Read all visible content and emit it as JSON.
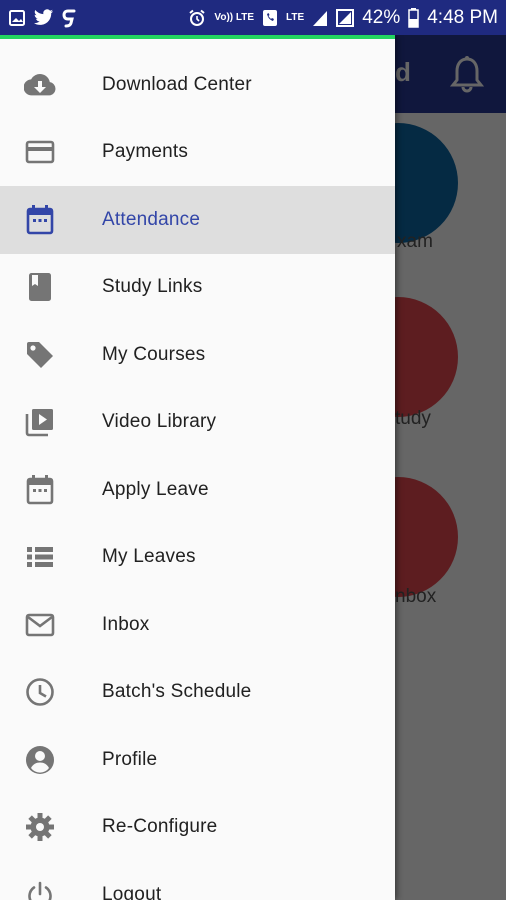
{
  "status_bar": {
    "battery_percent": "42%",
    "time": "4:48 PM",
    "volte_label": "Vo)) LTE",
    "lte_label": "LTE"
  },
  "background_screen": {
    "title_fragment": "d",
    "tiles": [
      {
        "label": "xam",
        "color": "#0d6aa8"
      },
      {
        "label": "tudy",
        "color": "#e84a52"
      },
      {
        "label": "nbox",
        "color": "#e84a52"
      }
    ]
  },
  "drawer": {
    "accent_color": "#23d560",
    "active_color": "#3346a8",
    "items": [
      {
        "label": "Download Center",
        "icon": "cloud-download-icon"
      },
      {
        "label": "Payments",
        "icon": "credit-card-icon"
      },
      {
        "label": "Attendance",
        "icon": "calendar-icon",
        "active": true
      },
      {
        "label": "Study Links",
        "icon": "book-icon"
      },
      {
        "label": "My Courses",
        "icon": "tag-icon"
      },
      {
        "label": "Video Library",
        "icon": "video-library-icon"
      },
      {
        "label": "Apply Leave",
        "icon": "calendar-outline-icon"
      },
      {
        "label": "My Leaves",
        "icon": "list-icon"
      },
      {
        "label": "Inbox",
        "icon": "mail-icon"
      },
      {
        "label": "Batch's Schedule",
        "icon": "clock-icon"
      },
      {
        "label": "Profile",
        "icon": "account-icon"
      },
      {
        "label": "Re-Configure",
        "icon": "gear-icon"
      },
      {
        "label": "Logout",
        "icon": "power-icon"
      }
    ]
  }
}
